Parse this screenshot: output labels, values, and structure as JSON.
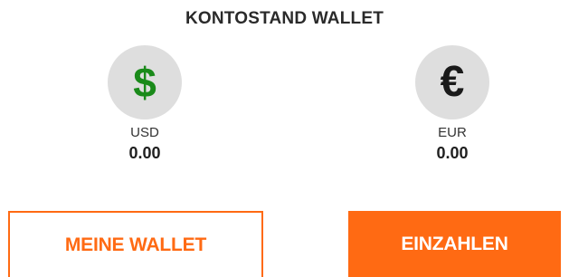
{
  "header": {
    "title": "KONTOSTAND WALLET"
  },
  "balances": [
    {
      "symbol": "$",
      "icon": "dollar-icon",
      "code": "USD",
      "amount": "0.00",
      "symbol_color": "#1a8a1a"
    },
    {
      "symbol": "€",
      "icon": "euro-icon",
      "code": "EUR",
      "amount": "0.00",
      "symbol_color": "#1a1a1a"
    }
  ],
  "actions": {
    "my_wallet_label": "MEINE WALLET",
    "deposit_label": "EINZAHLEN"
  },
  "colors": {
    "accent": "#ff6a13",
    "circle_bg": "#dedede"
  }
}
